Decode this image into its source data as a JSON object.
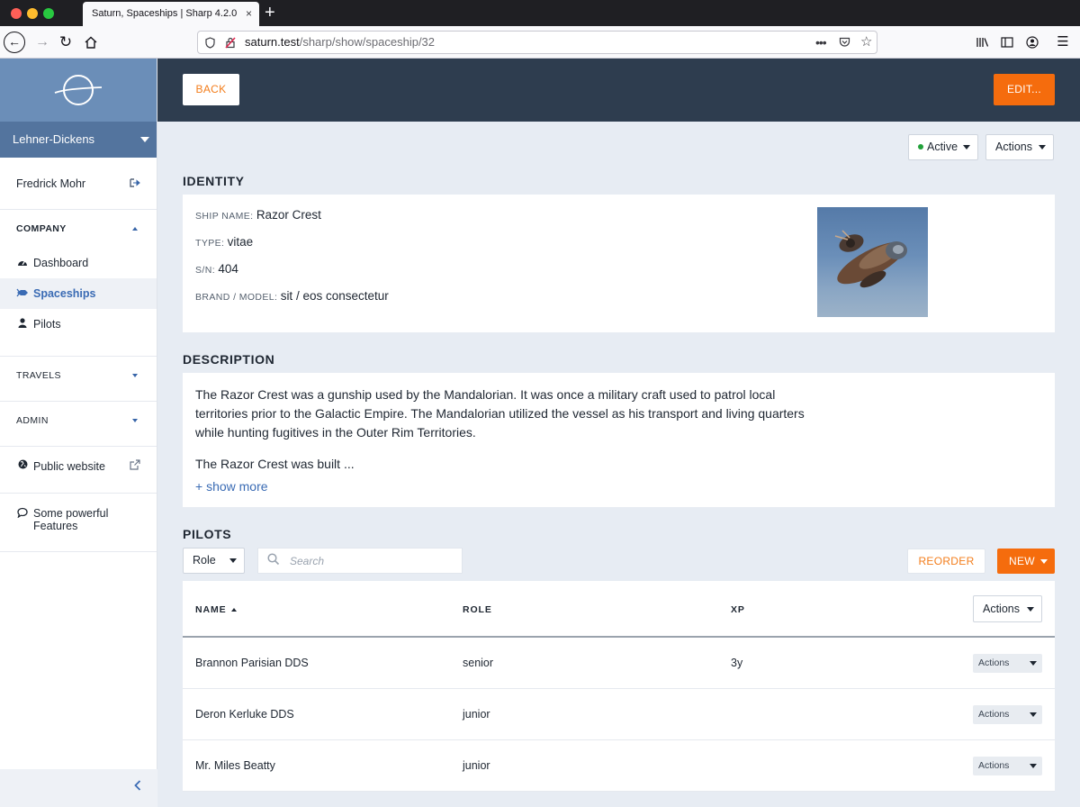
{
  "browser": {
    "tab_title": "Saturn, Spaceships | Sharp 4.2.0",
    "tab_close": "×",
    "new_tab": "+",
    "url_host": "saturn.test",
    "url_path": "/sharp/show/spaceship/32"
  },
  "sidebar": {
    "company": "Lehner-Dickens",
    "user": "Fredrick Mohr",
    "categories": [
      {
        "label": "COMPANY",
        "expanded": true,
        "items": [
          {
            "label": "Dashboard",
            "icon": "dashboard-icon"
          },
          {
            "label": "Spaceships",
            "icon": "spaceship-icon",
            "active": true
          },
          {
            "label": "Pilots",
            "icon": "user-icon"
          }
        ]
      },
      {
        "label": "TRAVELS",
        "expanded": false
      },
      {
        "label": "ADMIN",
        "expanded": false
      }
    ],
    "public_website": "Public website",
    "features_line1": "Some powerful",
    "features_line2": "Features"
  },
  "topbar": {
    "back_label": "BACK",
    "edit_label": "EDIT..."
  },
  "state": {
    "label": "Active",
    "color": "#22a13a"
  },
  "actions_label": "Actions",
  "identity": {
    "title": "IDENTITY",
    "fields": [
      {
        "label": "SHIP NAME",
        "value": "Razor Crest"
      },
      {
        "label": "TYPE",
        "value": "vitae"
      },
      {
        "label": "S/N",
        "value": "404"
      },
      {
        "label": "BRAND / MODEL",
        "value": "sit / eos consectetur"
      }
    ]
  },
  "description": {
    "title": "DESCRIPTION",
    "line1": "The Razor Crest was a gunship used by the Mandalorian. It was once a military craft used to patrol local",
    "line2": "territories prior to the Galactic Empire. The Mandalorian utilized the vessel as his transport and living quarters",
    "line3": "while hunting fugitives in the Outer Rim Territories.",
    "line4": "The Razor Crest was built ...",
    "show_more": "+ show more"
  },
  "pilots": {
    "title": "PILOTS",
    "role_filter": "Role",
    "search_placeholder": "Search",
    "reorder_label": "REORDER",
    "new_label": "NEW",
    "columns": [
      "NAME",
      "ROLE",
      "XP"
    ],
    "rows": [
      {
        "name": "Brannon Parisian DDS",
        "role": "senior",
        "xp": "3y"
      },
      {
        "name": "Deron Kerluke DDS",
        "role": "junior",
        "xp": ""
      },
      {
        "name": "Mr. Miles Beatty",
        "role": "junior",
        "xp": ""
      }
    ]
  },
  "colors": {
    "accent": "#f56c0d",
    "topbar": "#2e3d4f",
    "brand": "#6b8eb8",
    "link": "#3a6bb4"
  }
}
